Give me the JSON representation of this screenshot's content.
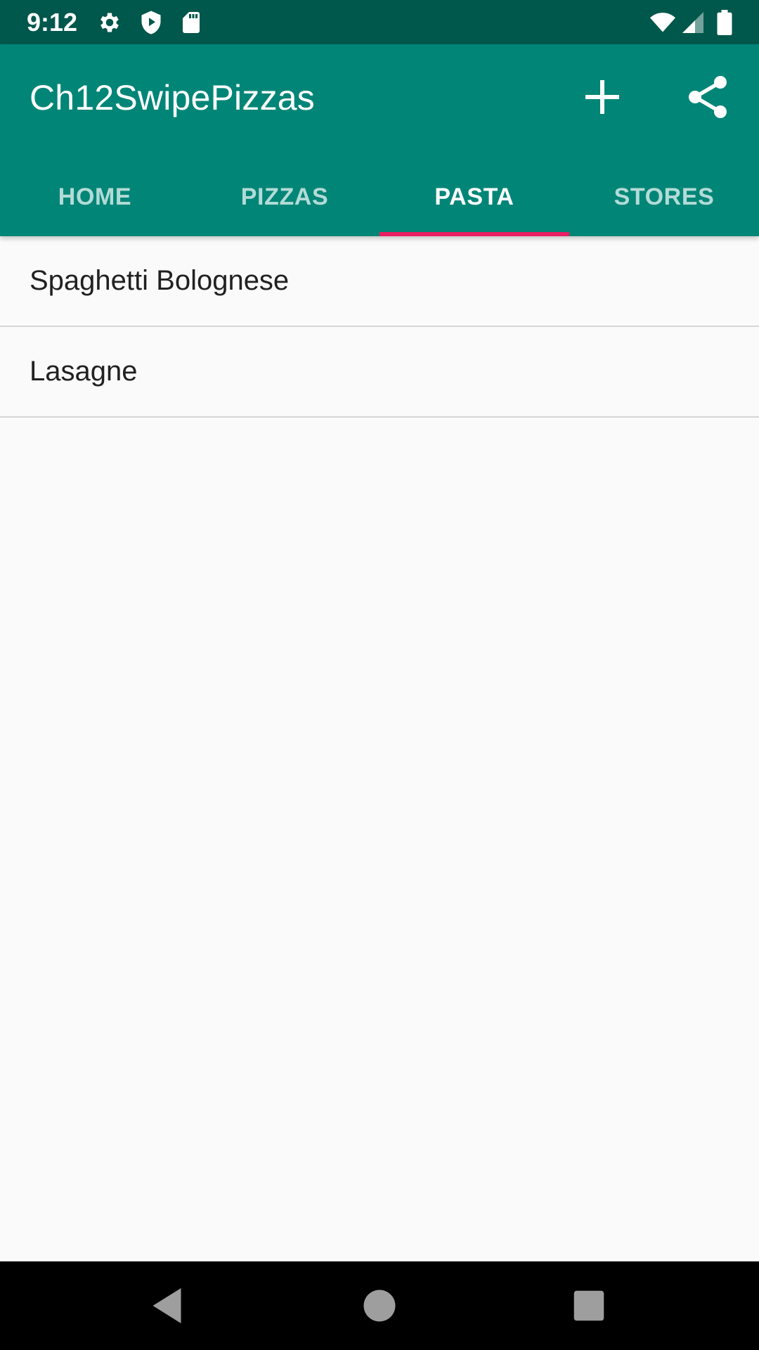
{
  "status_bar": {
    "time": "9:12",
    "left_icons": [
      "gear-icon",
      "shield-play-icon",
      "sd-card-icon"
    ],
    "right_icons": [
      "wifi-icon",
      "cell-signal-icon",
      "battery-icon"
    ]
  },
  "app_bar": {
    "title": "Ch12SwipePizzas",
    "actions": [
      {
        "name": "add-button",
        "icon": "plus-icon"
      },
      {
        "name": "share-button",
        "icon": "share-icon"
      }
    ]
  },
  "tabs": [
    {
      "label": "HOME",
      "active": false
    },
    {
      "label": "PIZZAS",
      "active": false
    },
    {
      "label": "PASTA",
      "active": true
    },
    {
      "label": "STORES",
      "active": false
    }
  ],
  "list": {
    "items": [
      {
        "label": "Spaghetti Bolognese"
      },
      {
        "label": "Lasagne"
      }
    ]
  },
  "nav_bar": {
    "buttons": [
      "back-icon",
      "home-icon",
      "recents-icon"
    ]
  },
  "colors": {
    "status_bar": "#00574b",
    "primary": "#008577",
    "accent": "#e91e63",
    "background": "#fafafa",
    "divider": "#d6d6d6",
    "nav_bar": "#000000",
    "nav_icon": "#9e9e9e"
  }
}
